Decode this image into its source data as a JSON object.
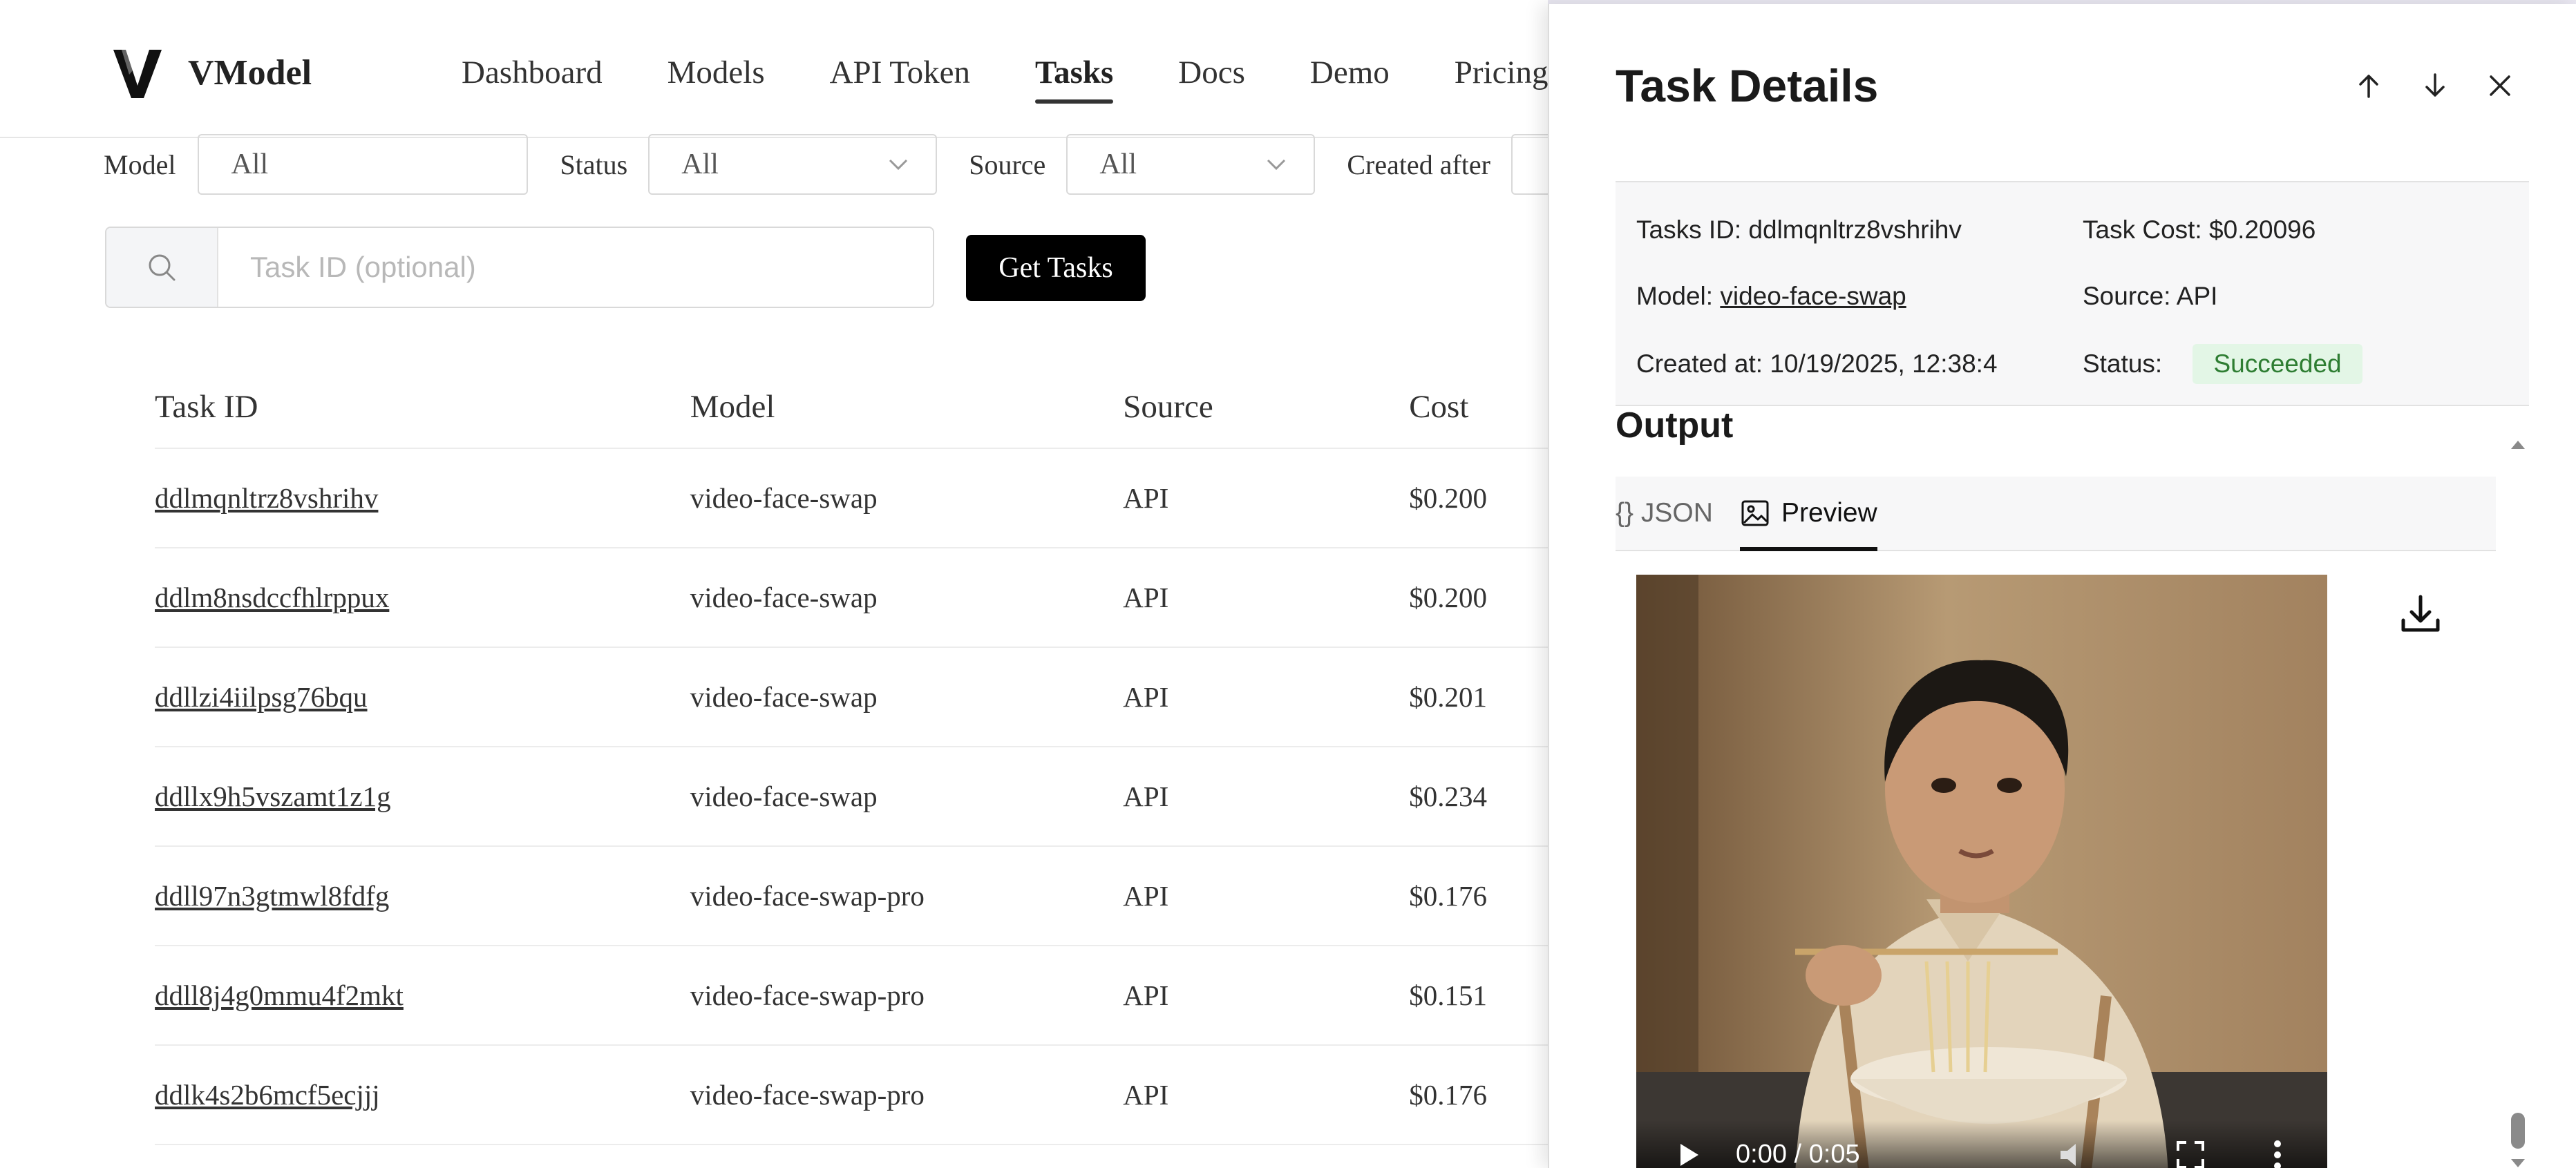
{
  "header": {
    "brand": "VModel",
    "nav": [
      "Dashboard",
      "Models",
      "API Token",
      "Tasks",
      "Docs",
      "Demo",
      "Pricing"
    ],
    "active_nav": "Tasks"
  },
  "filters": {
    "model_label": "Model",
    "model_value": "All",
    "status_label": "Status",
    "status_value": "All",
    "source_label": "Source",
    "source_value": "All",
    "created_label": "Created after"
  },
  "search": {
    "placeholder": "Task ID (optional)",
    "button": "Get Tasks"
  },
  "table": {
    "headers": [
      "Task ID",
      "Model",
      "Source",
      "Cost"
    ],
    "rows": [
      {
        "id": "ddlmqnltrz8vshrihv",
        "model": "video-face-swap",
        "source": "API",
        "cost": "$0.200"
      },
      {
        "id": "ddlm8nsdccfhlrppux",
        "model": "video-face-swap",
        "source": "API",
        "cost": "$0.200"
      },
      {
        "id": "ddllzi4iilpsg76bqu",
        "model": "video-face-swap",
        "source": "API",
        "cost": "$0.201"
      },
      {
        "id": "ddllx9h5vszamt1z1g",
        "model": "video-face-swap",
        "source": "API",
        "cost": "$0.234"
      },
      {
        "id": "ddll97n3gtmwl8fdfg",
        "model": "video-face-swap-pro",
        "source": "API",
        "cost": "$0.176"
      },
      {
        "id": "ddll8j4g0mmu4f2mkt",
        "model": "video-face-swap-pro",
        "source": "API",
        "cost": "$0.151"
      },
      {
        "id": "ddlk4s2b6mcf5ecjjj",
        "model": "video-face-swap-pro",
        "source": "API",
        "cost": "$0.176"
      }
    ]
  },
  "drawer": {
    "title": "Task Details",
    "task_id_label": "Tasks ID:",
    "task_id": "ddlmqnltrz8vshrihv",
    "cost_label": "Task Cost:",
    "cost": "$0.20096",
    "model_label": "Model:",
    "model": "video-face-swap",
    "source_label": "Source:",
    "source": "API",
    "created_label": "Created at:",
    "created": "10/19/2025, 12:38:4",
    "status_label": "Status:",
    "status": "Succeeded",
    "output_title": "Output",
    "tab_json": "{} JSON",
    "tab_preview": "Preview",
    "video_time": "0:00 / 0:05"
  },
  "colors": {
    "accent": "#000000",
    "success_bg": "#e3f6e6",
    "success_text": "#2e7d32"
  }
}
